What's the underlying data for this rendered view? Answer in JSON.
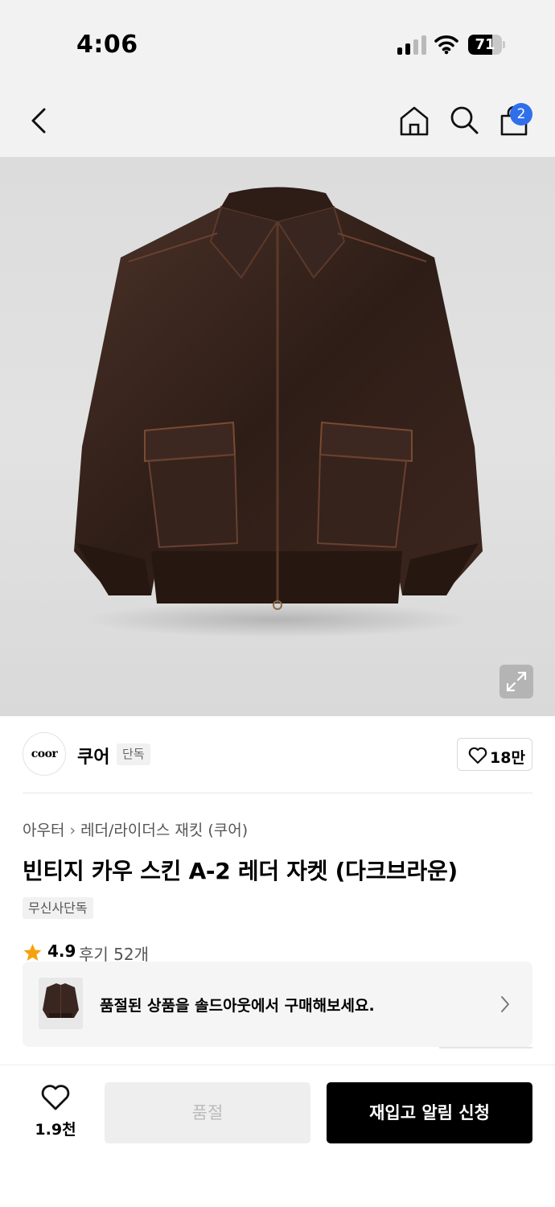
{
  "status_bar": {
    "time": "4:06",
    "battery_percent": "71",
    "battery_level": 0.71,
    "signal_bars_active": 2,
    "signal_bars_total": 4
  },
  "nav": {
    "cart_count": "2",
    "icons": [
      "chevron-left-icon",
      "home-icon",
      "search-icon",
      "shopping-bag-icon"
    ]
  },
  "hero": {
    "image_subject": "dark brown leather A-2 jacket"
  },
  "brand": {
    "logo_text": "coor",
    "name": "쿠어",
    "exclusive_tag": "단독",
    "like_count": "18만"
  },
  "product": {
    "breadcrumb": [
      "아우터",
      "레더/라이더스 재킷 (쿠어)"
    ],
    "title": "빈티지 카우 스킨 A-2 레더 자켓 (다크브라운)",
    "musinsa_tag": "무신사단독",
    "rating": "4.9",
    "review_link": "후기 52개"
  },
  "soldout_banner": {
    "text": "품절된 상품을 솔드아웃에서 구매해보세요."
  },
  "bottom_bar": {
    "wish_count": "1.9천",
    "soldout_label": "품절",
    "restock_label": "재입고 알림 신청"
  },
  "colors": {
    "badge_blue": "#2f6fec",
    "star_orange": "#f5a10d",
    "primary_black": "#000000",
    "disabled_gray": "#eeeeee"
  }
}
